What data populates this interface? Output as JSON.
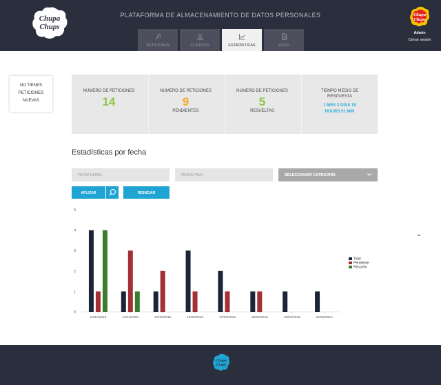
{
  "header": {
    "title": "PLATAFORMA DE ALMACENAMIENTO DE DATOS PERSONALES",
    "logo_text": [
      "Chupa",
      "Chups"
    ],
    "tabs": [
      {
        "label": "PETICIONES",
        "icon": "key-icon",
        "active": false
      },
      {
        "label": "CLIENTES",
        "icon": "user-icon",
        "active": false
      },
      {
        "label": "ESTADÍSTICAS",
        "icon": "chart-line-icon",
        "active": true
      },
      {
        "label": "LOGS",
        "icon": "document-icon",
        "active": false
      }
    ],
    "user": "Admin",
    "logout": "Cerrar sesión"
  },
  "notice": {
    "lines": [
      "NO TIENES",
      "PETICIONES",
      "NUEVAS"
    ]
  },
  "stats": [
    {
      "label": "NÚMERO DE PETICIONES",
      "value": "14",
      "sub": ""
    },
    {
      "label": "NÚMERO DE PETICIONES",
      "value": "9",
      "sub": "PENDIENTES"
    },
    {
      "label": "NÚMERO DE PETICIONES",
      "value": "5",
      "sub": "RESUELTAS"
    },
    {
      "label": "TIEMPO MEDIO DE RESPUESTA",
      "time": "1 MES 2 DÍAS 19 HOURS 51 MIN"
    }
  ],
  "colors": {
    "header_bg": "#2b2e3d",
    "accent": "#1fa4d4",
    "value_green": "#8cc63f",
    "time_blue": "#29a8e0",
    "total": "#1a2538",
    "pendiente": "#a33035",
    "resuelto": "#3a7d2c"
  },
  "section_title": "Estadísticas por fecha",
  "filters": {
    "start_placeholder": "FECHA INICIAL",
    "end_placeholder": "FECHA FINAL",
    "category": "SELECCIONAR CATEGORÍA",
    "apply": "APLICAR",
    "reset": "REINICIAR"
  },
  "chart_data": {
    "type": "bar",
    "categories": [
      "10/11/2015",
      "11/11/2015",
      "10/12/2015",
      "12/02/2016",
      "17/02/2016",
      "18/02/2016",
      "19/02/2016",
      "22/02/2016"
    ],
    "series": [
      {
        "name": "Total",
        "values": [
          4,
          1,
          1,
          3,
          2,
          1,
          1,
          1
        ]
      },
      {
        "name": "Pendiente",
        "values": [
          1,
          3,
          2,
          1,
          1,
          1,
          0,
          0
        ]
      },
      {
        "name": "Resuelto",
        "values": [
          4,
          1,
          0,
          0,
          0,
          0,
          0,
          0
        ]
      }
    ],
    "yticks": [
      "0",
      "1",
      "2",
      "3",
      "4",
      "5"
    ],
    "ylim": [
      0,
      5
    ],
    "legend_position": "right",
    "grid": false
  }
}
